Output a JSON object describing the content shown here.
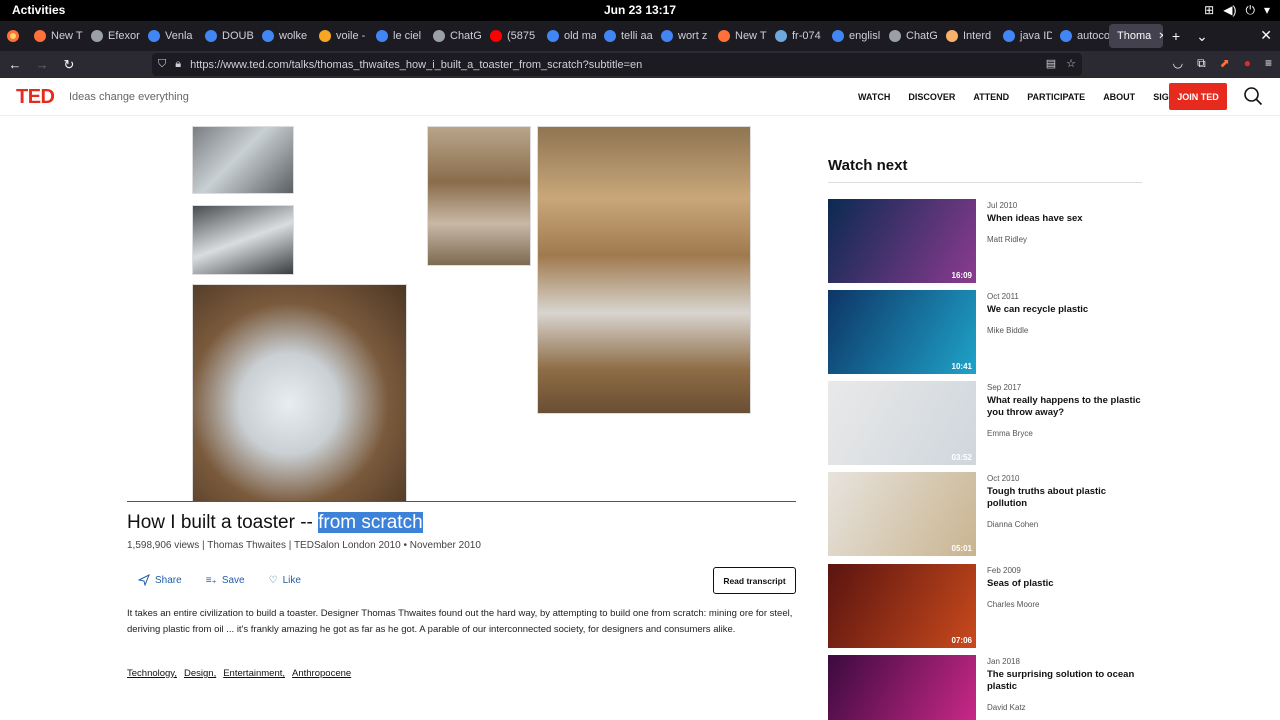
{
  "system": {
    "activities": "Activities",
    "clock": "Jun 23  13:17"
  },
  "browser": {
    "tabs": [
      {
        "label": "New T",
        "color": "#ff7139"
      },
      {
        "label": "Efexor",
        "color": "#9aa0a6"
      },
      {
        "label": "Venla",
        "color": "#4285f4"
      },
      {
        "label": "DOUB",
        "color": "#4285f4"
      },
      {
        "label": "wolke",
        "color": "#4285f4"
      },
      {
        "label": "voile -",
        "color": "#f5a623"
      },
      {
        "label": "le ciel",
        "color": "#4285f4"
      },
      {
        "label": "ChatG",
        "color": "#9aa0a6"
      },
      {
        "label": "(5875",
        "color": "#ff0000"
      },
      {
        "label": "old ma",
        "color": "#4285f4"
      },
      {
        "label": "telli aa",
        "color": "#4285f4"
      },
      {
        "label": "wort z",
        "color": "#4285f4"
      },
      {
        "label": "New T",
        "color": "#ff7139"
      },
      {
        "label": "fr-074",
        "color": "#6fa8dc"
      },
      {
        "label": "englisl",
        "color": "#4285f4"
      },
      {
        "label": "ChatG",
        "color": "#9aa0a6"
      },
      {
        "label": "Interd",
        "color": "#f6b26b"
      },
      {
        "label": "java ID",
        "color": "#4285f4"
      },
      {
        "label": "autoco",
        "color": "#4285f4"
      }
    ],
    "active_tab": "Thoma",
    "url": "https://www.ted.com/talks/thomas_thwaites_how_i_built_a_toaster_from_scratch?subtitle=en"
  },
  "ted": {
    "logo": "TED",
    "tagline": "Ideas change everything",
    "nav": [
      "WATCH",
      "DISCOVER",
      "ATTEND",
      "PARTICIPATE",
      "ABOUT",
      "SIGN IN"
    ],
    "join": "JOIN TED"
  },
  "talk": {
    "title_pre": "How I built a toaster -- ",
    "title_hl": "from scratch",
    "meta": "1,598,906 views | Thomas Thwaites | TEDSalon London 2010 • November 2010",
    "share": "Share",
    "save": "Save",
    "like": "Like",
    "transcript": "Read transcript",
    "description": "It takes an entire civilization to build a toaster. Designer Thomas Thwaites found out the hard way, by attempting to build one from scratch: mining ore for steel, deriving plastic from oil ... it's frankly amazing he got as far as he got. A parable of our interconnected society, for designers and consumers alike.",
    "tags": [
      "Technology,",
      "Design,",
      "Entertainment,",
      "Anthropocene"
    ]
  },
  "watch_next": {
    "heading": "Watch next",
    "items": [
      {
        "date": "Jul 2010",
        "title": "When ideas have sex",
        "speaker": "Matt Ridley",
        "duration": "16:09",
        "c1": "#0b2a52",
        "c2": "#8c3b8f"
      },
      {
        "date": "Oct 2011",
        "title": "We can recycle plastic",
        "speaker": "Mike Biddle",
        "duration": "10:41",
        "c1": "#0d3566",
        "c2": "#1fa3c9"
      },
      {
        "date": "Sep 2017",
        "title": "What really happens to the plastic you throw away?",
        "speaker": "Emma Bryce",
        "duration": "03:52",
        "c1": "#e9e9e9",
        "c2": "#cfd6dc"
      },
      {
        "date": "Oct 2010",
        "title": "Tough truths about plastic pollution",
        "speaker": "Dianna Cohen",
        "duration": "05:01",
        "c1": "#e7e3dd",
        "c2": "#c9b48f"
      },
      {
        "date": "Feb 2009",
        "title": "Seas of plastic",
        "speaker": "Charles Moore",
        "duration": "07:06",
        "c1": "#5a1410",
        "c2": "#c94a1c"
      },
      {
        "date": "Jan 2018",
        "title": "The surprising solution to ocean plastic",
        "speaker": "David Katz",
        "duration": "",
        "c1": "#3b0a3f",
        "c2": "#d12a8c"
      }
    ]
  }
}
